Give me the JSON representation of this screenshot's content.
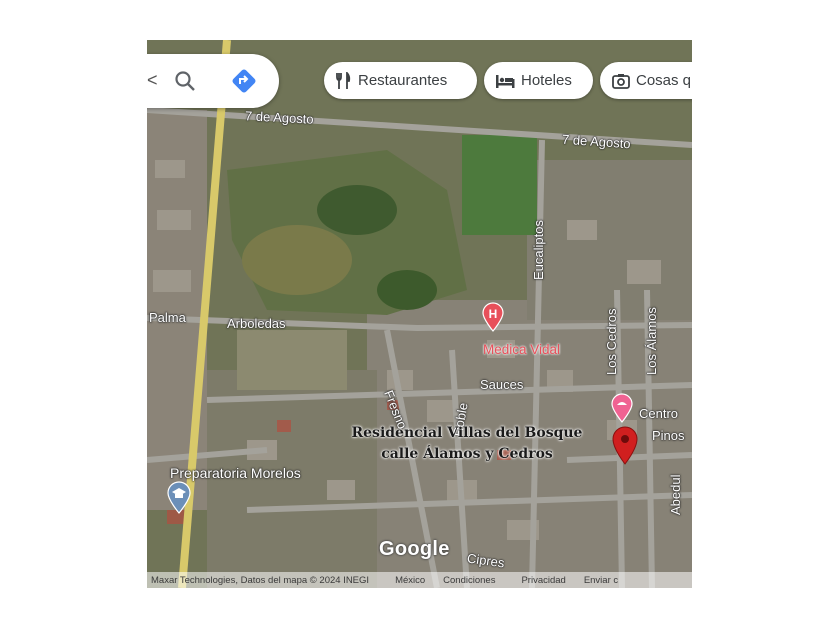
{
  "search": {
    "back_glyph": "<",
    "search_icon": "search-icon",
    "directions_icon": "directions-icon",
    "accent": "#4285f4"
  },
  "chips": [
    {
      "icon": "restaurant-icon",
      "label": "Restaurantes"
    },
    {
      "icon": "hotel-icon",
      "label": "Hoteles"
    },
    {
      "icon": "camera-icon",
      "label": "Cosas q"
    }
  ],
  "streets": {
    "agosto_1": "7 de Agosto",
    "agosto_2": "7 de Agosto",
    "eucaliptos": "Eucaliptos",
    "palma": "Palma",
    "arboledas": "Arboledas",
    "fresno": "Fresno",
    "roble": "Roble",
    "sauces": "Sauces",
    "cedros": "Los Cedros",
    "alamos": "Los Álamos",
    "pinos": "Pinos",
    "abedul": "Abedul",
    "cipres": "Cipres"
  },
  "places": {
    "medica": "Medica Vidal",
    "medica_color": "#e8505b",
    "centro": "Centro",
    "centro_color": "#f06292",
    "prepa": "Preparatoria Morelos"
  },
  "marker": {
    "label_line1": "Residencial Villas del Bosque",
    "label_line2": "calle Álamos y Cedros",
    "color": "#d01f1f"
  },
  "branding": "Google",
  "footer": {
    "attribution": "Maxar Technologies, Datos del mapa © 2024 INEGI",
    "mexico": "México",
    "conditions": "Condiciones",
    "privacy": "Privacidad",
    "send": "Enviar c"
  }
}
